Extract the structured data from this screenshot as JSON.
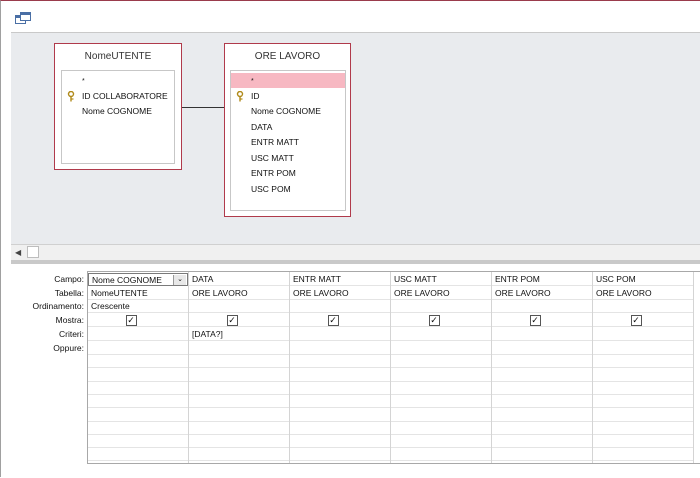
{
  "tables": [
    {
      "title": "NomeUTENTE",
      "fields": [
        {
          "label": "*",
          "key": false,
          "selected": false
        },
        {
          "label": "ID COLLABORATORE",
          "key": true,
          "selected": false
        },
        {
          "label": "Nome COGNOME",
          "key": false,
          "selected": false
        }
      ]
    },
    {
      "title": "ORE LAVORO",
      "fields": [
        {
          "label": "*",
          "key": false,
          "selected": true
        },
        {
          "label": "ID",
          "key": true,
          "selected": false
        },
        {
          "label": "Nome COGNOME",
          "key": false,
          "selected": false
        },
        {
          "label": "DATA",
          "key": false,
          "selected": false
        },
        {
          "label": "ENTR MATT",
          "key": false,
          "selected": false
        },
        {
          "label": "USC MATT",
          "key": false,
          "selected": false
        },
        {
          "label": "ENTR POM",
          "key": false,
          "selected": false
        },
        {
          "label": "USC POM",
          "key": false,
          "selected": false
        }
      ]
    }
  ],
  "grid": {
    "row_labels": [
      "Campo:",
      "Tabella:",
      "Ordinamento:",
      "Mostra:",
      "Criteri:",
      "Oppure:"
    ],
    "columns": [
      {
        "campo": "Nome COGNOME",
        "tabella": "NomeUTENTE",
        "ordinamento": "Crescente",
        "mostra": true,
        "criteri": "",
        "dropdown": true
      },
      {
        "campo": "DATA",
        "tabella": "ORE LAVORO",
        "ordinamento": "",
        "mostra": true,
        "criteri": "[DATA?]",
        "dropdown": false
      },
      {
        "campo": "ENTR MATT",
        "tabella": "ORE LAVORO",
        "ordinamento": "",
        "mostra": true,
        "criteri": "",
        "dropdown": false
      },
      {
        "campo": "USC MATT",
        "tabella": "ORE LAVORO",
        "ordinamento": "",
        "mostra": true,
        "criteri": "",
        "dropdown": false
      },
      {
        "campo": "ENTR POM",
        "tabella": "ORE LAVORO",
        "ordinamento": "",
        "mostra": true,
        "criteri": "",
        "dropdown": false
      },
      {
        "campo": "USC POM",
        "tabella": "ORE LAVORO",
        "ordinamento": "",
        "mostra": true,
        "criteri": "",
        "dropdown": false
      }
    ]
  },
  "icons": {
    "window": "query-design-icon",
    "key": "primary-key-icon",
    "dropdown": "chevron-down-icon",
    "scroll_left": "arrow-left-icon"
  },
  "colors": {
    "table_border": "#b03a4b",
    "selected_field": "#f7b8c2",
    "design_bg": "#e9ebee"
  }
}
